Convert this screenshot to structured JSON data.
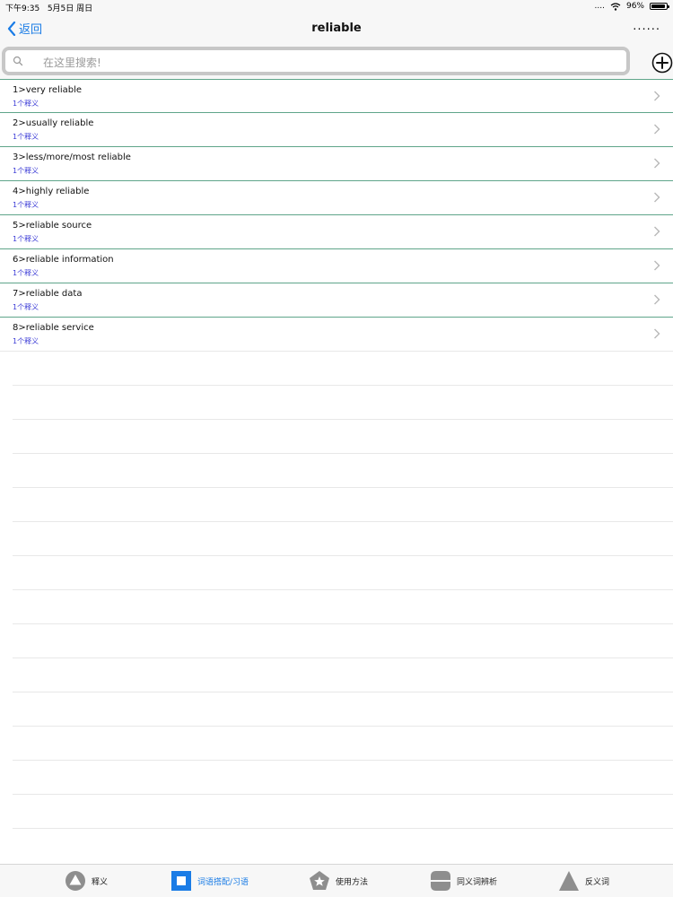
{
  "status": {
    "time": "下午9:35",
    "date": "5月5日 周日",
    "signal": "....",
    "battery": "96%",
    "battery_level": 0.96
  },
  "nav": {
    "back_label": "返回",
    "title": "reliable",
    "more_label": "......"
  },
  "search": {
    "placeholder": "在这里搜索!"
  },
  "items": [
    {
      "title": "1>very reliable",
      "sub": "1个释义"
    },
    {
      "title": "2>usually reliable",
      "sub": "1个释义"
    },
    {
      "title": "3>less/more/most reliable",
      "sub": "1个释义"
    },
    {
      "title": "4>highly reliable",
      "sub": "1个释义"
    },
    {
      "title": "5>reliable source",
      "sub": "1个释义"
    },
    {
      "title": "6>reliable information",
      "sub": "1个释义"
    },
    {
      "title": "7>reliable data",
      "sub": "1个释义"
    },
    {
      "title": "8>reliable service",
      "sub": "1个释义"
    }
  ],
  "tabs": [
    {
      "label": "释义",
      "icon": "triangle-circle-icon"
    },
    {
      "label": "词语搭配/习语",
      "icon": "square-icon",
      "active": true
    },
    {
      "label": "使用方法",
      "icon": "pentagon-star-icon"
    },
    {
      "label": "同义词辨析",
      "icon": "split-rounded-icon"
    },
    {
      "label": "反义词",
      "icon": "triangle-icon"
    }
  ],
  "colors": {
    "accent": "#1a7ce6",
    "divider": "#5fa58a",
    "subtitle": "#3b3bd6"
  }
}
